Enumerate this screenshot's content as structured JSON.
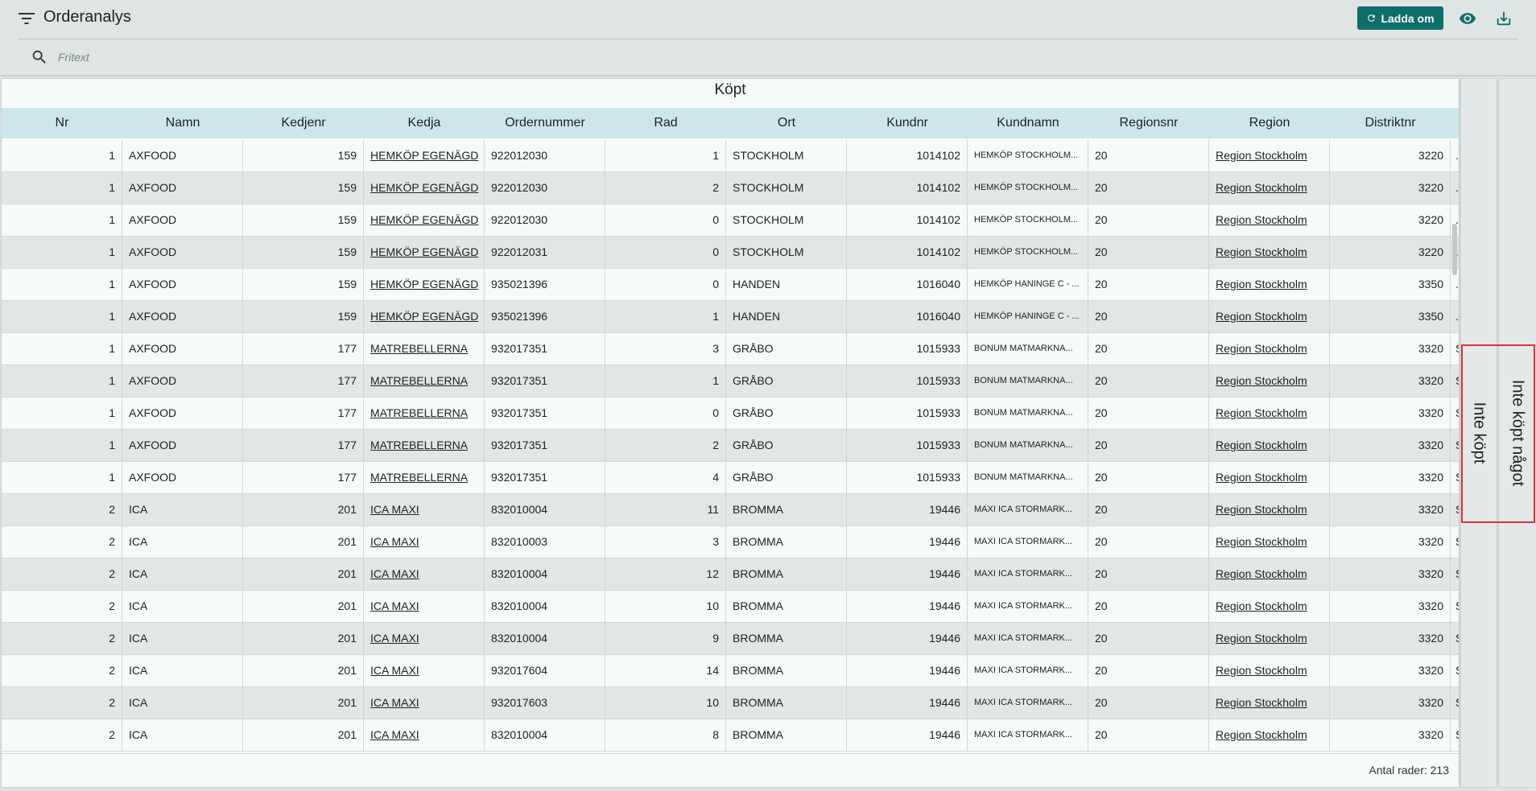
{
  "header": {
    "title": "Orderanalys",
    "reload_label": "Ladda om"
  },
  "search": {
    "placeholder": "Fritext"
  },
  "grid": {
    "title": "Köpt",
    "columns": [
      "Nr",
      "Namn",
      "Kedjenr",
      "Kedja",
      "Ordernummer",
      "Rad",
      "Ort",
      "Kundnr",
      "Kundnamn",
      "Regionsnr",
      "Region",
      "Distriktnr"
    ],
    "rows": [
      [
        "1",
        "AXFOOD",
        "159",
        "HEMKÖP EGENÄGD",
        "922012030",
        "1",
        "STOCKHOLM",
        "1014102",
        "HEMKÖP STOCKHOLM...",
        "20",
        "Region Stockholm",
        "3220",
        "."
      ],
      [
        "1",
        "AXFOOD",
        "159",
        "HEMKÖP EGENÄGD",
        "922012030",
        "2",
        "STOCKHOLM",
        "1014102",
        "HEMKÖP STOCKHOLM...",
        "20",
        "Region Stockholm",
        "3220",
        "."
      ],
      [
        "1",
        "AXFOOD",
        "159",
        "HEMKÖP EGENÄGD",
        "922012030",
        "0",
        "STOCKHOLM",
        "1014102",
        "HEMKÖP STOCKHOLM...",
        "20",
        "Region Stockholm",
        "3220",
        "."
      ],
      [
        "1",
        "AXFOOD",
        "159",
        "HEMKÖP EGENÄGD",
        "922012031",
        "0",
        "STOCKHOLM",
        "1014102",
        "HEMKÖP STOCKHOLM...",
        "20",
        "Region Stockholm",
        "3220",
        "."
      ],
      [
        "1",
        "AXFOOD",
        "159",
        "HEMKÖP EGENÄGD",
        "935021396",
        "0",
        "HANDEN",
        "1016040",
        "HEMKÖP HANINGE C - ...",
        "20",
        "Region Stockholm",
        "3350",
        "."
      ],
      [
        "1",
        "AXFOOD",
        "159",
        "HEMKÖP EGENÄGD",
        "935021396",
        "1",
        "HANDEN",
        "1016040",
        "HEMKÖP HANINGE C - ...",
        "20",
        "Region Stockholm",
        "3350",
        "."
      ],
      [
        "1",
        "AXFOOD",
        "177",
        "MATREBELLERNA",
        "932017351",
        "3",
        "GRÅBO",
        "1015933",
        "BONUM MATMARKNA...",
        "20",
        "Region Stockholm",
        "3320",
        "S"
      ],
      [
        "1",
        "AXFOOD",
        "177",
        "MATREBELLERNA",
        "932017351",
        "1",
        "GRÅBO",
        "1015933",
        "BONUM MATMARKNA...",
        "20",
        "Region Stockholm",
        "3320",
        "S"
      ],
      [
        "1",
        "AXFOOD",
        "177",
        "MATREBELLERNA",
        "932017351",
        "0",
        "GRÅBO",
        "1015933",
        "BONUM MATMARKNA...",
        "20",
        "Region Stockholm",
        "3320",
        "S"
      ],
      [
        "1",
        "AXFOOD",
        "177",
        "MATREBELLERNA",
        "932017351",
        "2",
        "GRÅBO",
        "1015933",
        "BONUM MATMARKNA...",
        "20",
        "Region Stockholm",
        "3320",
        "S"
      ],
      [
        "1",
        "AXFOOD",
        "177",
        "MATREBELLERNA",
        "932017351",
        "4",
        "GRÅBO",
        "1015933",
        "BONUM MATMARKNA...",
        "20",
        "Region Stockholm",
        "3320",
        "S"
      ],
      [
        "2",
        "ICA",
        "201",
        "ICA MAXI",
        "832010004",
        "11",
        "BROMMA",
        "19446",
        "MAXI ICA STORMARK...",
        "20",
        "Region Stockholm",
        "3320",
        "S"
      ],
      [
        "2",
        "ICA",
        "201",
        "ICA MAXI",
        "832010003",
        "3",
        "BROMMA",
        "19446",
        "MAXI ICA STORMARK...",
        "20",
        "Region Stockholm",
        "3320",
        "S"
      ],
      [
        "2",
        "ICA",
        "201",
        "ICA MAXI",
        "832010004",
        "12",
        "BROMMA",
        "19446",
        "MAXI ICA STORMARK...",
        "20",
        "Region Stockholm",
        "3320",
        "S"
      ],
      [
        "2",
        "ICA",
        "201",
        "ICA MAXI",
        "832010004",
        "10",
        "BROMMA",
        "19446",
        "MAXI ICA STORMARK...",
        "20",
        "Region Stockholm",
        "3320",
        "S"
      ],
      [
        "2",
        "ICA",
        "201",
        "ICA MAXI",
        "832010004",
        "9",
        "BROMMA",
        "19446",
        "MAXI ICA STORMARK...",
        "20",
        "Region Stockholm",
        "3320",
        "S"
      ],
      [
        "2",
        "ICA",
        "201",
        "ICA MAXI",
        "932017604",
        "14",
        "BROMMA",
        "19446",
        "MAXI ICA STORMARK...",
        "20",
        "Region Stockholm",
        "3320",
        "S"
      ],
      [
        "2",
        "ICA",
        "201",
        "ICA MAXI",
        "932017603",
        "10",
        "BROMMA",
        "19446",
        "MAXI ICA STORMARK...",
        "20",
        "Region Stockholm",
        "3320",
        "S"
      ],
      [
        "2",
        "ICA",
        "201",
        "ICA MAXI",
        "832010004",
        "8",
        "BROMMA",
        "19446",
        "MAXI ICA STORMARK...",
        "20",
        "Region Stockholm",
        "3320",
        "S"
      ]
    ],
    "footer": "Antal rader: 213"
  },
  "side_tabs": {
    "not_bought": "Inte köpt",
    "not_bought_anything": "Inte köpt något"
  },
  "icons": {
    "filter": "filter-icon",
    "reload": "refresh-icon",
    "view": "eye-icon",
    "download": "download-icon",
    "search": "search-icon"
  },
  "colors": {
    "accent": "#0e6e6a",
    "header_row": "#cde7e9",
    "highlight": "#d9343a"
  }
}
